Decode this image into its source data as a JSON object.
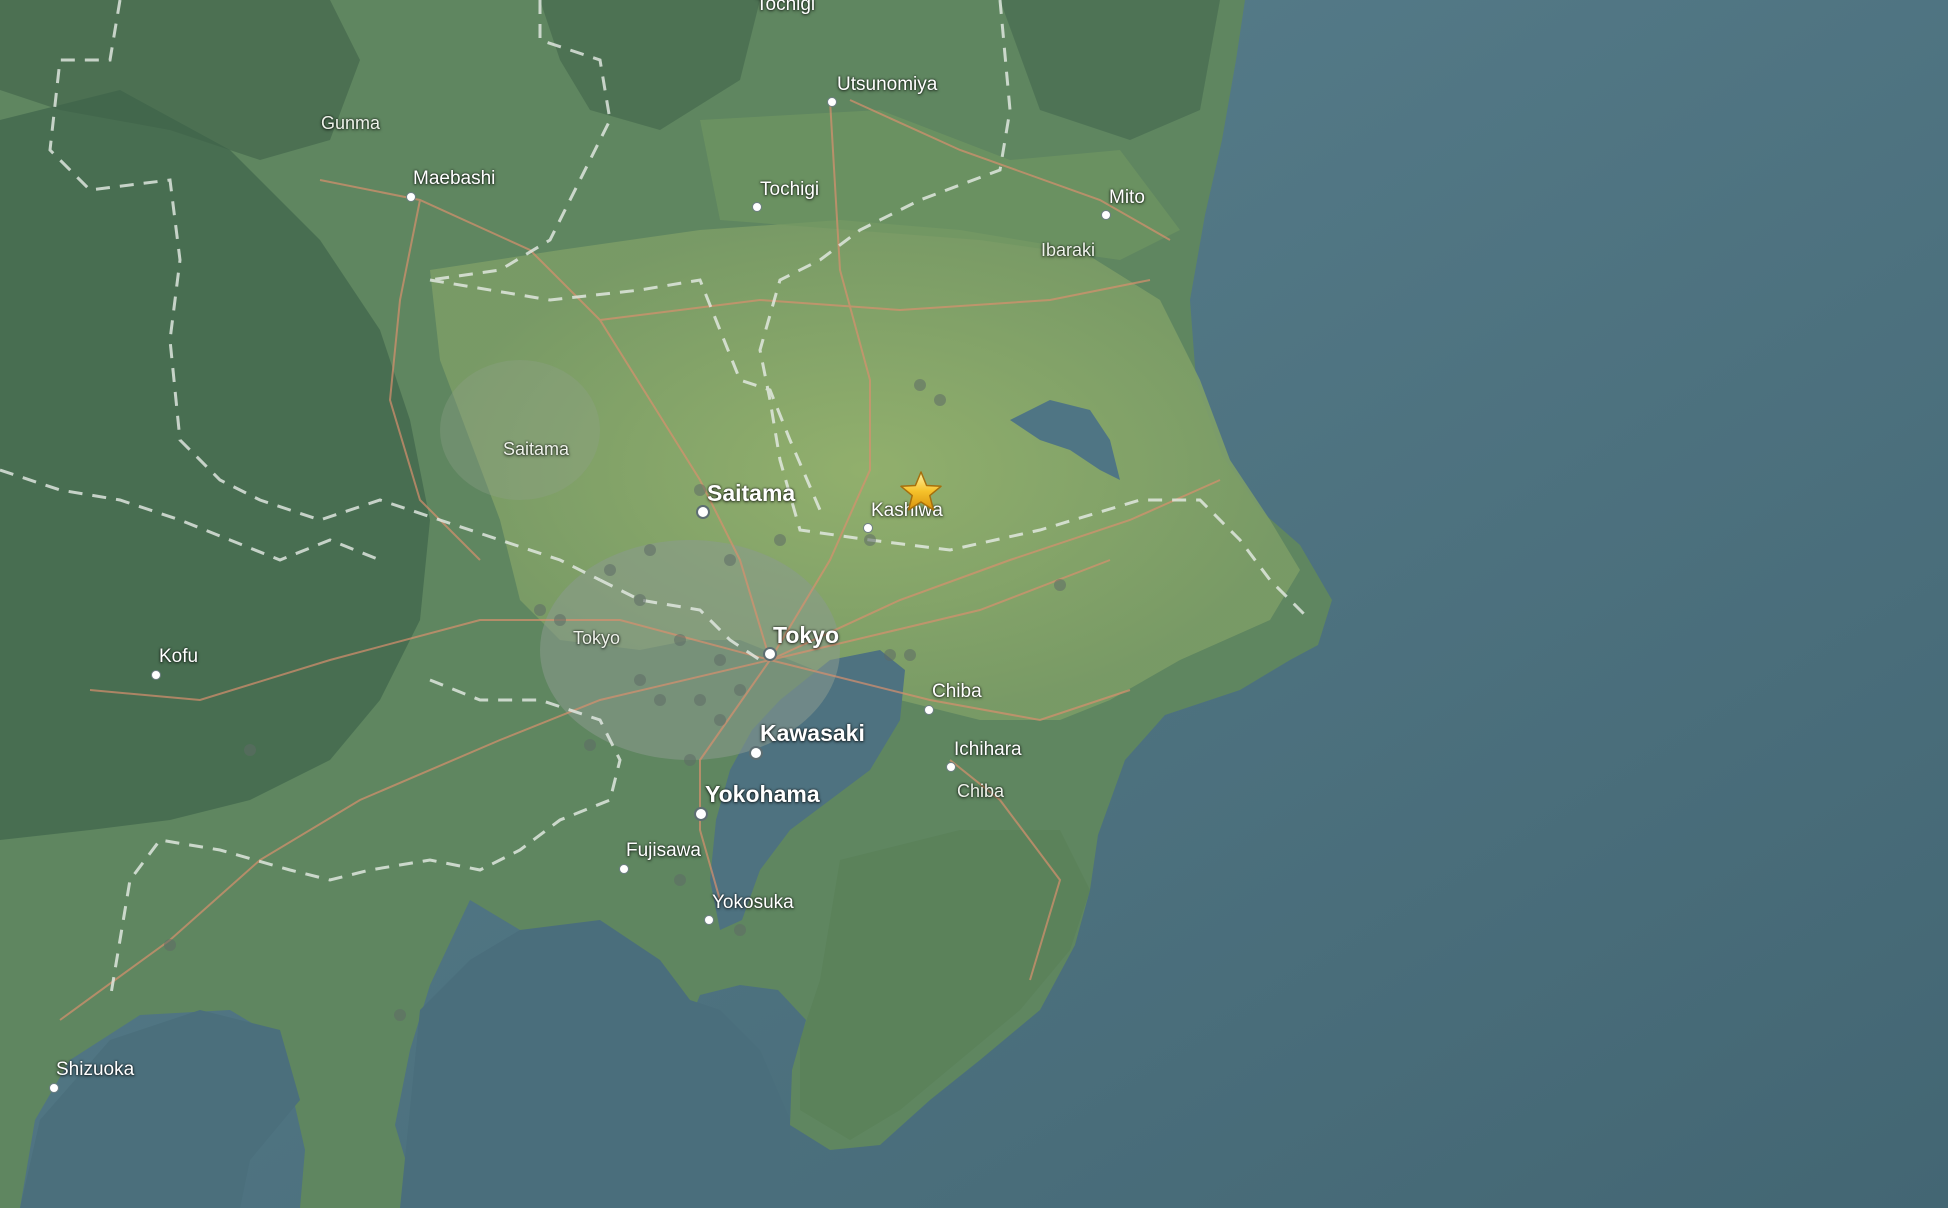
{
  "map": {
    "labels": {
      "tochigi_top": "Tochigi",
      "utsunomiya": "Utsunomiya",
      "gunma": "Gunma",
      "maebashi": "Maebashi",
      "tochigi": "Tochigi",
      "mito": "Mito",
      "ibaraki": "Ibaraki",
      "saitama_pref": "Saitama",
      "saitama": "Saitama",
      "kashiwa": "Kashiwa",
      "tokyo_pref": "Tokyo",
      "tokyo": "Tokyo",
      "kofu": "Kofu",
      "chiba": "Chiba",
      "kawasaki": "Kawasaki",
      "ichihara": "Ichihara",
      "chiba_pref": "Chiba",
      "yokohama": "Yokohama",
      "fujisawa": "Fujisawa",
      "yokosuka": "Yokosuka",
      "shizuoka": "Shizuoka"
    },
    "marker": {
      "icon": "star-icon",
      "color": "#f6c22b"
    },
    "colors": {
      "ocean": "#4f7280",
      "plain": "#7fa26a",
      "mountain": "#4f7356",
      "road": "#d9906e",
      "border": "#e6ece6"
    }
  }
}
